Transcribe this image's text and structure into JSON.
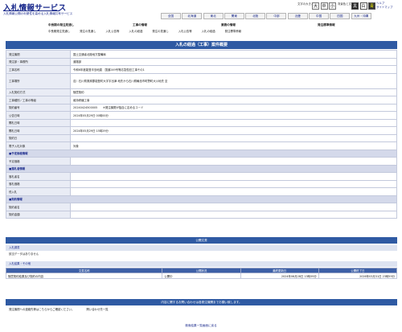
{
  "header": {
    "title": "入札情報サービス",
    "subtitle": "入札情報公開の利便性を高める入札情報共有サービス",
    "font_size_label": "文字の大きさ",
    "font_sizes": [
      "大",
      "中",
      "小"
    ],
    "color_label": "背景色と文字色",
    "colors": [
      "黒",
      "白",
      "青"
    ],
    "help_links": [
      "ヘルプ",
      "サイトマップ"
    ]
  },
  "regions": [
    "全国",
    "北海道",
    "東北",
    "関東",
    "北陸",
    "中部",
    "近畿",
    "中国",
    "四国",
    "九州・沖縄"
  ],
  "category_nav": {
    "groups": [
      "中長期の発注見通し",
      "工事の情報",
      "業務の情報",
      "発注標準情報"
    ],
    "tabs": [
      "中長期発注見通し",
      "発注の見通し",
      "入札公告等",
      "入札の経過",
      "発注の見通し",
      "入札公告等",
      "入札の経過",
      "発注標準情報"
    ]
  },
  "detail": {
    "title": "入札の経過（工事）案件概要",
    "rows": [
      {
        "label": "発注機関",
        "value": "国土交通省北陸地方整備局"
      },
      {
        "label": "発注部・事務所",
        "value": "道路部"
      },
      {
        "label": "工事名称",
        "value": "令和6年度能登半島地震　国道249号等応急復旧工事その1"
      },
      {
        "label": "工事場所",
        "value": "自）石川県鳳珠郡能登町大字宇出津 地先から石川県輪島市町野町大川地先 至"
      },
      {
        "label": "入札契約方式",
        "value": "随意契約"
      },
      {
        "label": "工事種別／工事の等級",
        "value": "維持修繕工事"
      },
      {
        "label": "契約番号",
        "value": "20240424500005　　※発注機関が独自に定めるコード"
      },
      {
        "label": "公告日時",
        "value": "2024年05月29日 00時00分"
      },
      {
        "label": "開札日時",
        "value": ""
      },
      {
        "label": "開札日時",
        "value": "2024年05月29日 15時29分"
      },
      {
        "label": "契約日",
        "value": ""
      },
      {
        "label": "電子入札対象",
        "value": "対象"
      }
    ],
    "section_price": "■予定価格情報",
    "price_rows": [
      {
        "label": "予定価格",
        "value": ""
      }
    ],
    "section_winner": "■落札者情報",
    "winner_rows": [
      {
        "label": "落札者名",
        "value": ""
      },
      {
        "label": "落札価格",
        "value": ""
      },
      {
        "label": "低入札",
        "value": ""
      }
    ],
    "section_contract": "■契約情報",
    "contract_rows": [
      {
        "label": "契約者名",
        "value": ""
      },
      {
        "label": "契約金額",
        "value": ""
      }
    ]
  },
  "result": {
    "title": "公開文書",
    "result_sub": "入札調書",
    "result_none": "該当データはありません",
    "docs_sub": "入札結果・その他",
    "columns": [
      "文書名称",
      "公開状況",
      "最終更新日",
      "公開終了日"
    ],
    "docs": [
      {
        "name": "随意契約結果及び契約の内容",
        "status": "公開中",
        "updated": "2024年06月28日 13時59分",
        "end": "2026年03月31日 23時59分"
      }
    ]
  },
  "contact": {
    "title": "内容に関するお問い合わせは各発注機関までお願い致します。",
    "text": "発注機関への連絡先等はこちらからご確認ください。",
    "link": "問い合わせ先一覧"
  },
  "footer": {
    "back_link": "検索結果一覧画面に戻る"
  }
}
